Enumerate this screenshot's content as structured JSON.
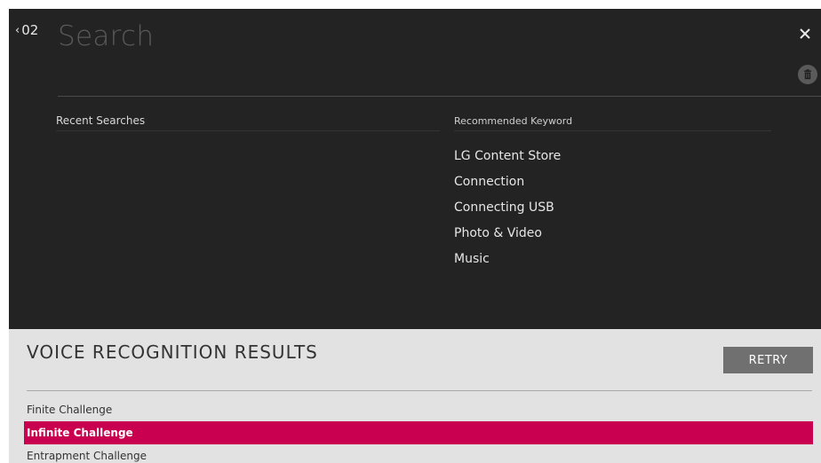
{
  "header": {
    "back_label": "02",
    "search_title": "Search"
  },
  "recent": {
    "header": "Recent Searches"
  },
  "recommended": {
    "header": "Recommended Keyword",
    "items": [
      "LG Content Store",
      "Connection",
      "Connecting USB",
      "Photo & Video",
      "Music"
    ]
  },
  "voice": {
    "title": "VOICE RECOGNITION RESULTS",
    "retry_label": "RETRY",
    "results": [
      {
        "label": "Finite Challenge",
        "selected": false
      },
      {
        "label": "Infinite Challenge",
        "selected": true
      },
      {
        "label": "Entrapment Challenge",
        "selected": false
      }
    ]
  },
  "colors": {
    "dark_bg": "#232323",
    "light_bg": "#e2e2e2",
    "accent": "#c8004f",
    "retry_bg": "#707070"
  },
  "icons": {
    "back": "chevron-left-icon",
    "close": "close-icon",
    "trash": "trash-icon"
  }
}
